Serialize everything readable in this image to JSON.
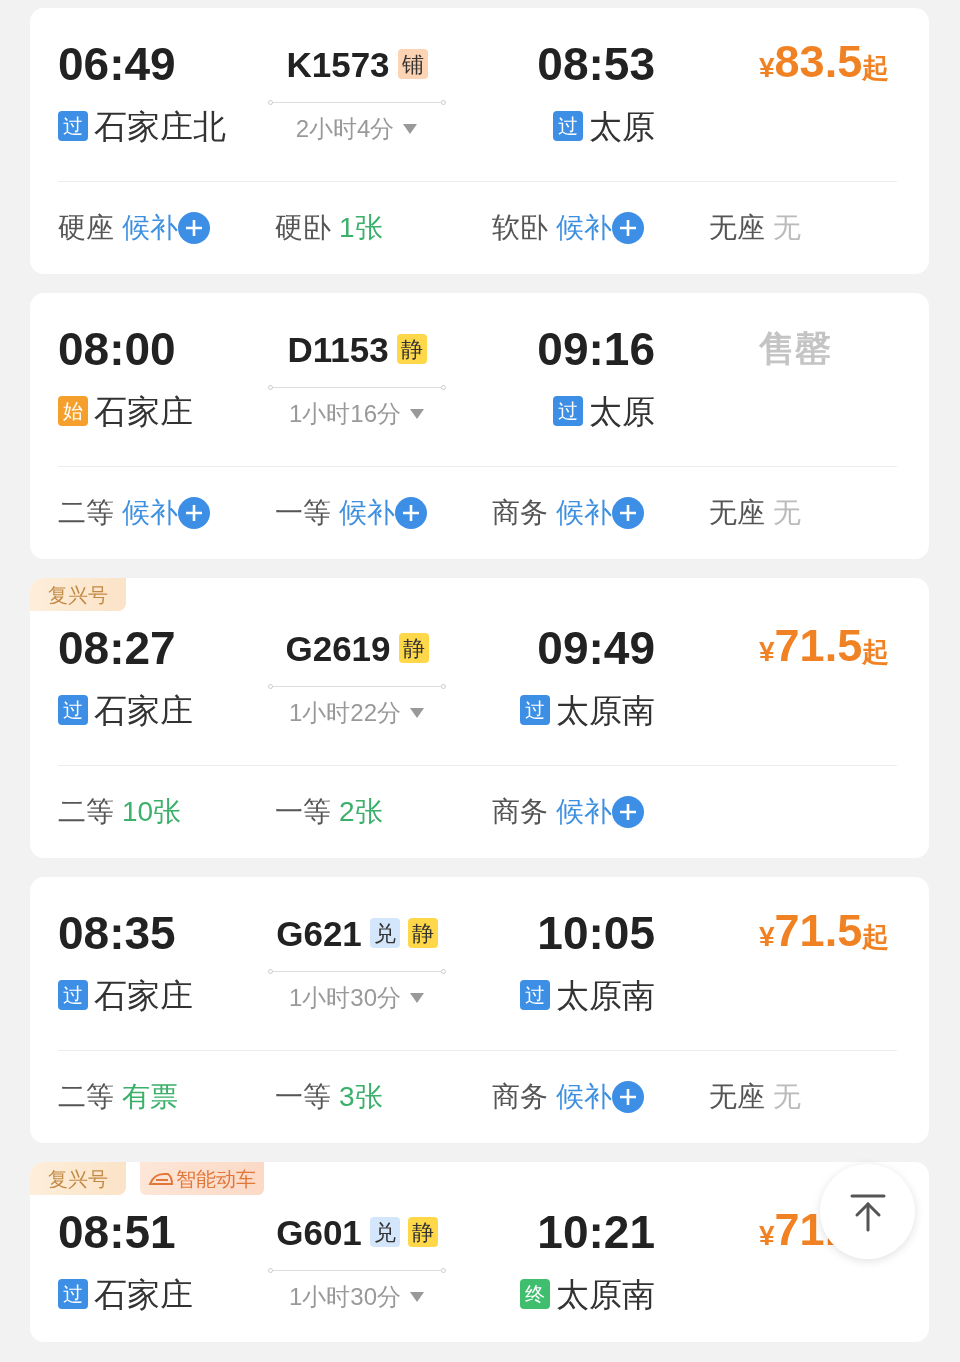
{
  "trains": [
    {
      "depart_time": "06:49",
      "depart_station": {
        "badge": "过",
        "kind": "pass",
        "name": "石家庄北"
      },
      "train_no": "K1573",
      "train_badges": [
        {
          "label": "铺",
          "kind": "berth"
        }
      ],
      "duration": "2小时4分",
      "arrive_time": "08:53",
      "arrive_station": {
        "badge": "过",
        "kind": "pass",
        "name": "太原"
      },
      "price": {
        "currency": "¥",
        "amount": "83.5",
        "suffix": "起"
      },
      "seats": [
        {
          "class": "硬座",
          "status": "候补",
          "kind": "waitlist"
        },
        {
          "class": "硬卧",
          "status": "1张",
          "kind": "available"
        },
        {
          "class": "软卧",
          "status": "候补",
          "kind": "waitlist"
        },
        {
          "class": "无座",
          "status": "无",
          "kind": "none"
        }
      ]
    },
    {
      "depart_time": "08:00",
      "depart_station": {
        "badge": "始",
        "kind": "start",
        "name": "石家庄"
      },
      "train_no": "D1153",
      "train_badges": [
        {
          "label": "静",
          "kind": "quiet"
        }
      ],
      "duration": "1小时16分",
      "arrive_time": "09:16",
      "arrive_station": {
        "badge": "过",
        "kind": "pass",
        "name": "太原"
      },
      "sold_out": "售罄",
      "seats": [
        {
          "class": "二等",
          "status": "候补",
          "kind": "waitlist"
        },
        {
          "class": "一等",
          "status": "候补",
          "kind": "waitlist"
        },
        {
          "class": "商务",
          "status": "候补",
          "kind": "waitlist"
        },
        {
          "class": "无座",
          "status": "无",
          "kind": "none"
        }
      ]
    },
    {
      "tags": [
        {
          "label": "复兴号",
          "kind": "plain"
        }
      ],
      "depart_time": "08:27",
      "depart_station": {
        "badge": "过",
        "kind": "pass",
        "name": "石家庄"
      },
      "train_no": "G2619",
      "train_badges": [
        {
          "label": "静",
          "kind": "quiet"
        }
      ],
      "duration": "1小时22分",
      "arrive_time": "09:49",
      "arrive_station": {
        "badge": "过",
        "kind": "pass",
        "name": "太原南"
      },
      "price": {
        "currency": "¥",
        "amount": "71.5",
        "suffix": "起"
      },
      "seats": [
        {
          "class": "二等",
          "status": "10张",
          "kind": "available"
        },
        {
          "class": "一等",
          "status": "2张",
          "kind": "available"
        },
        {
          "class": "商务",
          "status": "候补",
          "kind": "waitlist"
        }
      ]
    },
    {
      "depart_time": "08:35",
      "depart_station": {
        "badge": "过",
        "kind": "pass",
        "name": "石家庄"
      },
      "train_no": "G621",
      "train_badges": [
        {
          "label": "兑",
          "kind": "exchange"
        },
        {
          "label": "静",
          "kind": "quiet"
        }
      ],
      "duration": "1小时30分",
      "arrive_time": "10:05",
      "arrive_station": {
        "badge": "过",
        "kind": "pass",
        "name": "太原南"
      },
      "price": {
        "currency": "¥",
        "amount": "71.5",
        "suffix": "起"
      },
      "seats": [
        {
          "class": "二等",
          "status": "有票",
          "kind": "available"
        },
        {
          "class": "一等",
          "status": "3张",
          "kind": "available"
        },
        {
          "class": "商务",
          "status": "候补",
          "kind": "waitlist"
        },
        {
          "class": "无座",
          "status": "无",
          "kind": "none"
        }
      ]
    },
    {
      "tags": [
        {
          "label": "复兴号",
          "kind": "plain"
        },
        {
          "label": "智能动车",
          "kind": "smart"
        }
      ],
      "depart_time": "08:51",
      "depart_station": {
        "badge": "过",
        "kind": "pass",
        "name": "石家庄"
      },
      "train_no": "G601",
      "train_badges": [
        {
          "label": "兑",
          "kind": "exchange"
        },
        {
          "label": "静",
          "kind": "quiet"
        }
      ],
      "duration": "1小时30分",
      "arrive_time": "10:21",
      "arrive_station": {
        "badge": "终",
        "kind": "end",
        "name": "太原南"
      },
      "price": {
        "currency": "¥",
        "amount": "71."
      }
    }
  ]
}
